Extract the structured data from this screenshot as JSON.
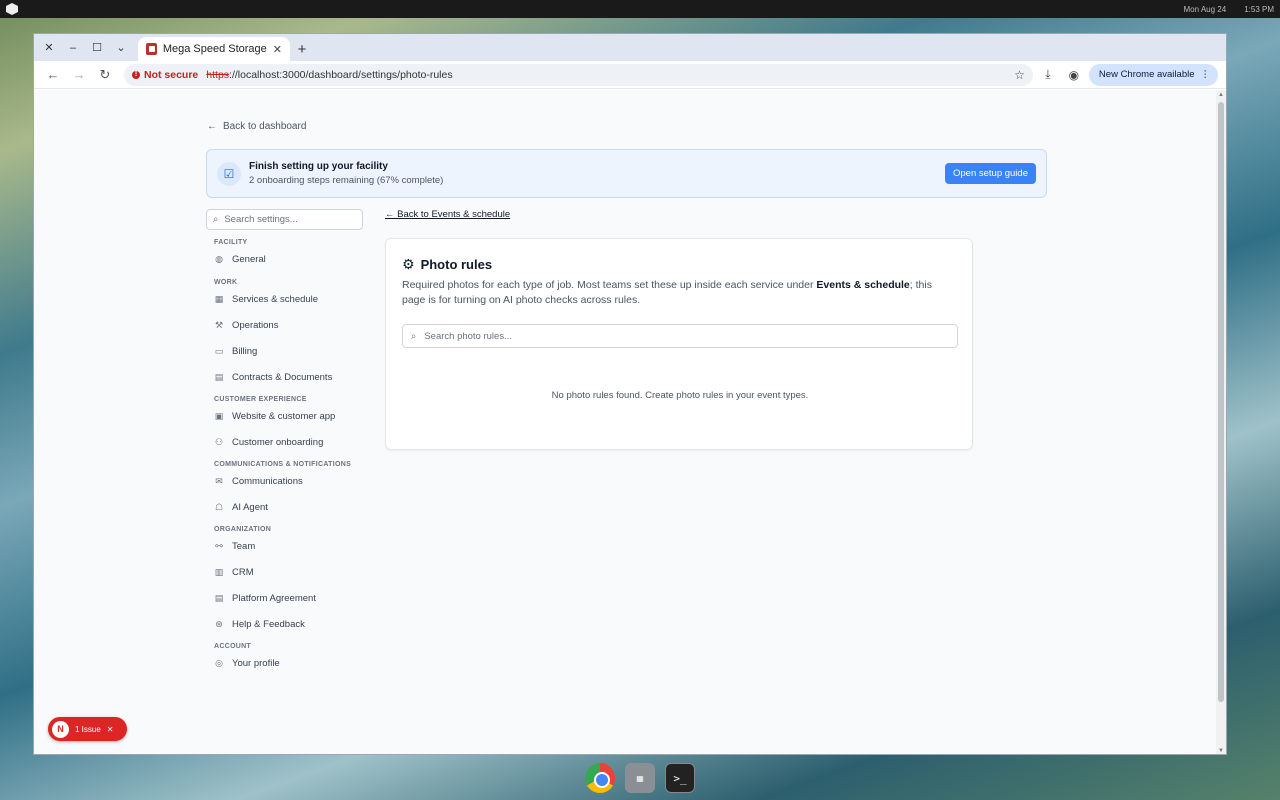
{
  "desktop": {
    "date": "Mon Aug 24",
    "time": "1:53 PM"
  },
  "browser": {
    "tab_title": "Mega Speed Storage",
    "not_secure": "Not secure",
    "url_scheme": "https",
    "url_rest": "://localhost:3000/dashboard/settings/photo-rules",
    "update_chip": "New Chrome available"
  },
  "page": {
    "back_dashboard": "Back to dashboard",
    "banner": {
      "title": "Finish setting up your facility",
      "subtitle": "2 onboarding steps remaining (67% complete)",
      "button": "Open setup guide"
    },
    "sidebar": {
      "search_placeholder": "Search settings...",
      "sections": [
        {
          "title": "FACILITY",
          "items": [
            "General"
          ]
        },
        {
          "title": "WORK",
          "items": [
            "Services & schedule",
            "Operations",
            "Billing",
            "Contracts & Documents"
          ]
        },
        {
          "title": "CUSTOMER EXPERIENCE",
          "items": [
            "Website & customer app",
            "Customer onboarding"
          ]
        },
        {
          "title": "COMMUNICATIONS & NOTIFICATIONS",
          "items": [
            "Communications",
            "AI Agent"
          ]
        },
        {
          "title": "ORGANIZATION",
          "items": [
            "Team",
            "CRM",
            "Platform Agreement",
            "Help & Feedback"
          ]
        },
        {
          "title": "ACCOUNT",
          "items": [
            "Your profile"
          ]
        }
      ]
    },
    "back_events": "← Back to Events & schedule",
    "card": {
      "title": "Photo rules",
      "desc_part1": "Required photos for each type of job. Most teams set these up inside each service under ",
      "desc_bold": "Events & schedule",
      "desc_part2": "; this page is for turning on AI photo checks across rules.",
      "search_placeholder": "Search photo rules...",
      "empty_text": "No photo rules found. Create photo rules in your event types."
    },
    "issue_badge": {
      "letter": "N",
      "label": "1 Issue"
    }
  }
}
